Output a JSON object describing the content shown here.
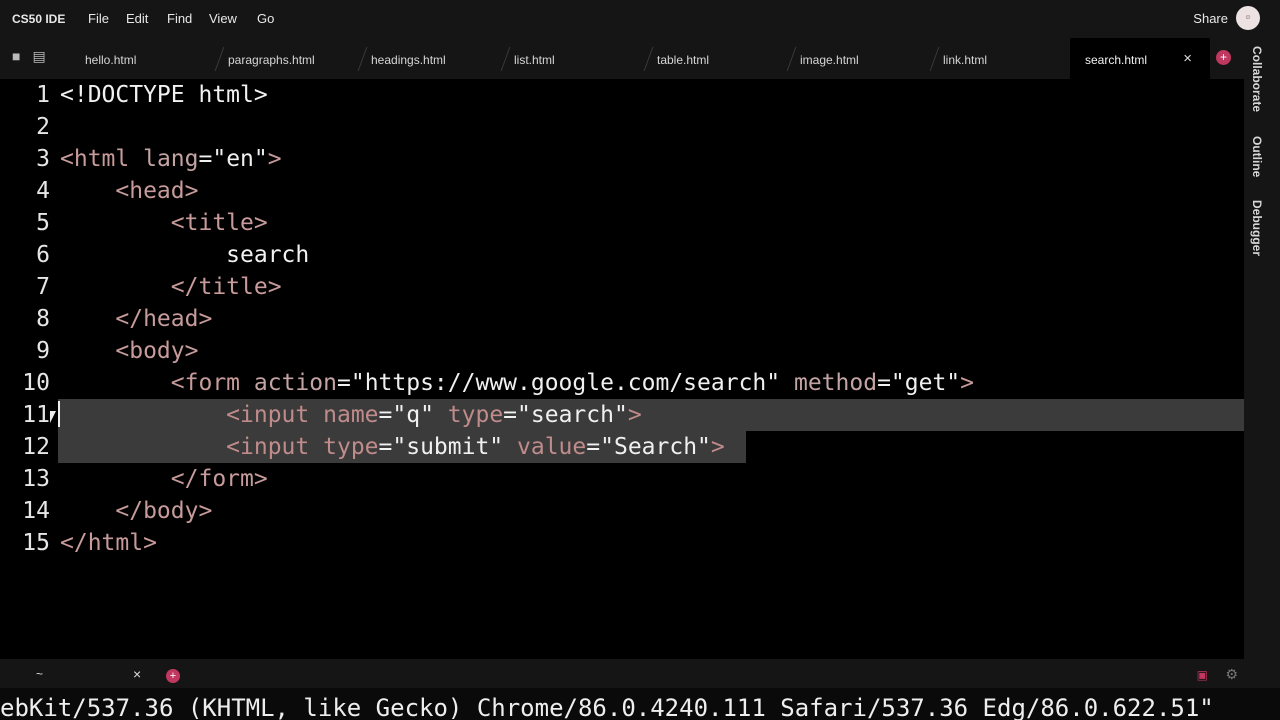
{
  "menubar": {
    "brand": "CS50 IDE",
    "items": [
      "File",
      "Edit",
      "Find",
      "View",
      "Go"
    ],
    "share": "Share"
  },
  "tabs": [
    {
      "label": "hello.html"
    },
    {
      "label": "paragraphs.html"
    },
    {
      "label": "headings.html"
    },
    {
      "label": "list.html"
    },
    {
      "label": "table.html"
    },
    {
      "label": "image.html"
    },
    {
      "label": "link.html"
    },
    {
      "label": "search.html",
      "active": true
    }
  ],
  "sidebar": {
    "tabs": [
      "Collaborate",
      "Outline",
      "Debugger"
    ]
  },
  "editor": {
    "lines": [
      {
        "num": "1",
        "tokens": [
          [
            "c-txt",
            "<!DOCTYPE html>"
          ]
        ]
      },
      {
        "num": "2",
        "tokens": []
      },
      {
        "num": "3",
        "tokens": [
          [
            "c-tag",
            "<html"
          ],
          [
            "c-txt",
            " "
          ],
          [
            "c-attr",
            "lang"
          ],
          [
            "c-txt",
            "="
          ],
          [
            "c-str",
            "\"en\""
          ],
          [
            "c-tag",
            ">"
          ]
        ]
      },
      {
        "num": "4",
        "tokens": [
          [
            "c-txt",
            "    "
          ],
          [
            "c-tag",
            "<head>"
          ]
        ]
      },
      {
        "num": "5",
        "tokens": [
          [
            "c-txt",
            "        "
          ],
          [
            "c-tag",
            "<title>"
          ]
        ]
      },
      {
        "num": "6",
        "tokens": [
          [
            "c-txt",
            "            search"
          ]
        ]
      },
      {
        "num": "7",
        "tokens": [
          [
            "c-txt",
            "        "
          ],
          [
            "c-tag",
            "</title>"
          ]
        ]
      },
      {
        "num": "8",
        "tokens": [
          [
            "c-txt",
            "    "
          ],
          [
            "c-tag",
            "</head>"
          ]
        ]
      },
      {
        "num": "9",
        "tokens": [
          [
            "c-txt",
            "    "
          ],
          [
            "c-tag",
            "<body>"
          ]
        ]
      },
      {
        "num": "10",
        "tokens": [
          [
            "c-txt",
            "        "
          ],
          [
            "c-tag",
            "<form"
          ],
          [
            "c-txt",
            " "
          ],
          [
            "c-attr",
            "action"
          ],
          [
            "c-txt",
            "="
          ],
          [
            "c-str",
            "\"https://www.google.com/search\""
          ],
          [
            "c-txt",
            " "
          ],
          [
            "c-attr",
            "method"
          ],
          [
            "c-txt",
            "="
          ],
          [
            "c-str",
            "\"get\""
          ],
          [
            "c-tag",
            ">"
          ]
        ]
      },
      {
        "num": "11",
        "selected": true,
        "tokens": [
          [
            "c-txt",
            "            "
          ],
          [
            "c-tag",
            "<input"
          ],
          [
            "c-txt",
            " "
          ],
          [
            "c-attr",
            "name"
          ],
          [
            "c-txt",
            "="
          ],
          [
            "c-str",
            "\"q\""
          ],
          [
            "c-txt",
            " "
          ],
          [
            "c-attr",
            "type"
          ],
          [
            "c-txt",
            "="
          ],
          [
            "c-str",
            "\"search\""
          ],
          [
            "c-tag",
            ">"
          ]
        ]
      },
      {
        "num": "12",
        "selected": true,
        "tokens": [
          [
            "c-txt",
            "            "
          ],
          [
            "c-tag",
            "<input"
          ],
          [
            "c-txt",
            " "
          ],
          [
            "c-attr",
            "type"
          ],
          [
            "c-txt",
            "="
          ],
          [
            "c-str",
            "\"submit\""
          ],
          [
            "c-txt",
            " "
          ],
          [
            "c-attr",
            "value"
          ],
          [
            "c-txt",
            "="
          ],
          [
            "c-str",
            "\"Search\""
          ],
          [
            "c-tag",
            ">"
          ]
        ]
      },
      {
        "num": "13",
        "tokens": [
          [
            "c-txt",
            "        "
          ],
          [
            "c-tag",
            "</form>"
          ]
        ]
      },
      {
        "num": "14",
        "tokens": [
          [
            "c-txt",
            "    "
          ],
          [
            "c-tag",
            "</body>"
          ]
        ]
      },
      {
        "num": "15",
        "tokens": [
          [
            "c-tag",
            "</html>"
          ]
        ]
      }
    ]
  },
  "terminal": {
    "tab_title": "~",
    "output": "ebKit/537.36 (KHTML, like Gecko) Chrome/86.0.4240.111 Safari/537.36 Edg/86.0.622.51\""
  },
  "icons": {
    "folder": "folder-icon",
    "files": "files-icon",
    "close": "close-icon",
    "add": "plus-icon",
    "avatar": "user-avatar"
  },
  "colors": {
    "accent": "#c0375f",
    "selection": "#3b3b3b",
    "tag": "#c79b9b"
  }
}
